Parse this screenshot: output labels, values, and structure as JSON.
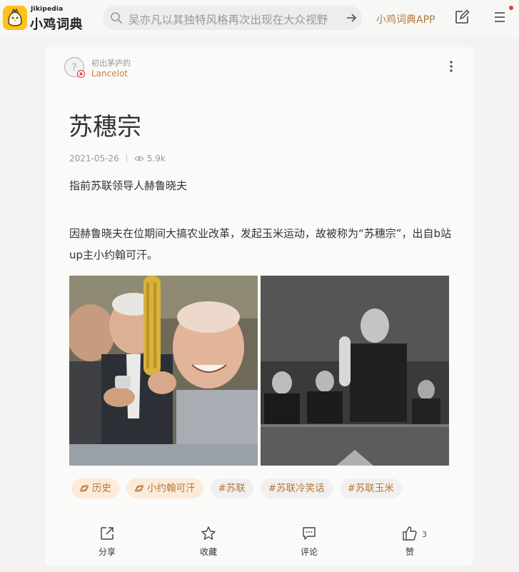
{
  "header": {
    "logo_sub": "Jikipedia",
    "logo_name": "小鸡词典",
    "search_placeholder": "吴亦凡以其独特风格再次出现在大众视野",
    "app_link": "小鸡词典APP",
    "icons": [
      "search-icon",
      "arrow-right-icon",
      "edit-icon",
      "menu-icon"
    ]
  },
  "author": {
    "tag": "初出茅庐的",
    "name": "Lancelot"
  },
  "entry": {
    "title": "苏穗宗",
    "date": "2021-05-26",
    "views": "5.9k",
    "definition": "指前苏联领导人赫鲁晓夫",
    "explanation": "因赫鲁晓夫在位期间大搞农业改革，发起玉米运动，故被称为“苏穗宗”，出自b站up主小约翰可汗。"
  },
  "tags": [
    {
      "label": "历史",
      "kind": "category"
    },
    {
      "label": "小约翰可汗",
      "kind": "category"
    },
    {
      "label": "#苏联",
      "kind": "topic"
    },
    {
      "label": "#苏联冷笑话",
      "kind": "topic"
    },
    {
      "label": "#苏联玉米",
      "kind": "topic"
    }
  ],
  "actions": {
    "share": "分享",
    "favorite": "收藏",
    "comment": "评论",
    "like": "赞",
    "like_count": "3"
  },
  "colors": {
    "accent": "#b07a3c",
    "logo_bg": "#ffc21a",
    "tag_bg": "#fcebd8",
    "notify": "#e53935"
  }
}
